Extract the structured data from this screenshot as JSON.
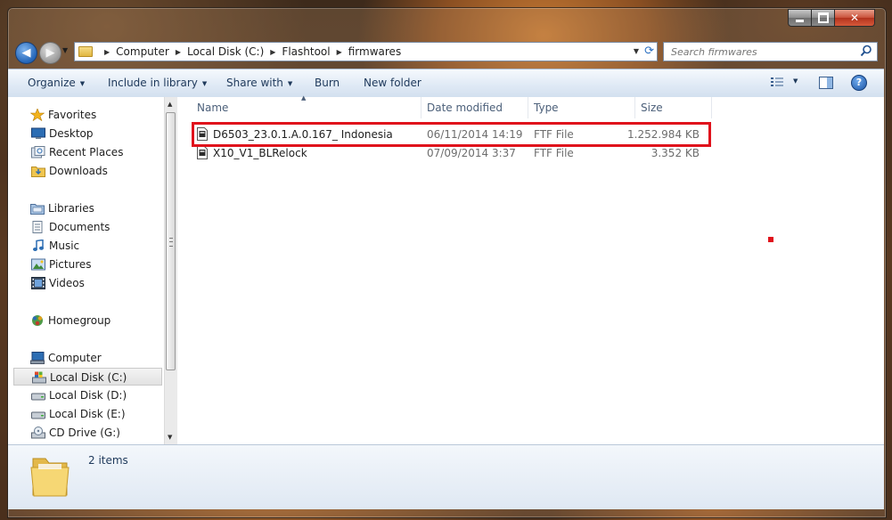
{
  "address": {
    "crumbs": [
      "Computer",
      "Local Disk (C:)",
      "Flashtool",
      "firmwares"
    ]
  },
  "search": {
    "placeholder": "Search firmwares"
  },
  "toolbar": {
    "organize": "Organize",
    "include_in_library": "Include in library",
    "share_with": "Share with",
    "burn": "Burn",
    "new_folder": "New folder"
  },
  "nav": {
    "favorites": "Favorites",
    "desktop": "Desktop",
    "recent_places": "Recent Places",
    "downloads": "Downloads",
    "libraries": "Libraries",
    "documents": "Documents",
    "music": "Music",
    "pictures": "Pictures",
    "videos": "Videos",
    "homegroup": "Homegroup",
    "computer": "Computer",
    "local_c": "Local Disk (C:)",
    "local_d": "Local Disk (D:)",
    "local_e": "Local Disk (E:)",
    "cd_drive": "CD Drive (G:)"
  },
  "columns": {
    "name": "Name",
    "date": "Date modified",
    "type": "Type",
    "size": "Size"
  },
  "files": [
    {
      "name": "D6503_23.0.1.A.0.167_ Indonesia",
      "date": "06/11/2014 14:19",
      "type": "FTF File",
      "size": "1.252.984 KB"
    },
    {
      "name": "X10_V1_BLRelock",
      "date": "07/09/2014 3:37",
      "type": "FTF File",
      "size": "3.352 KB"
    }
  ],
  "details": {
    "count": "2 items"
  },
  "colors": {
    "highlight": "#e0121c",
    "toolbar_text": "#1e395b"
  }
}
